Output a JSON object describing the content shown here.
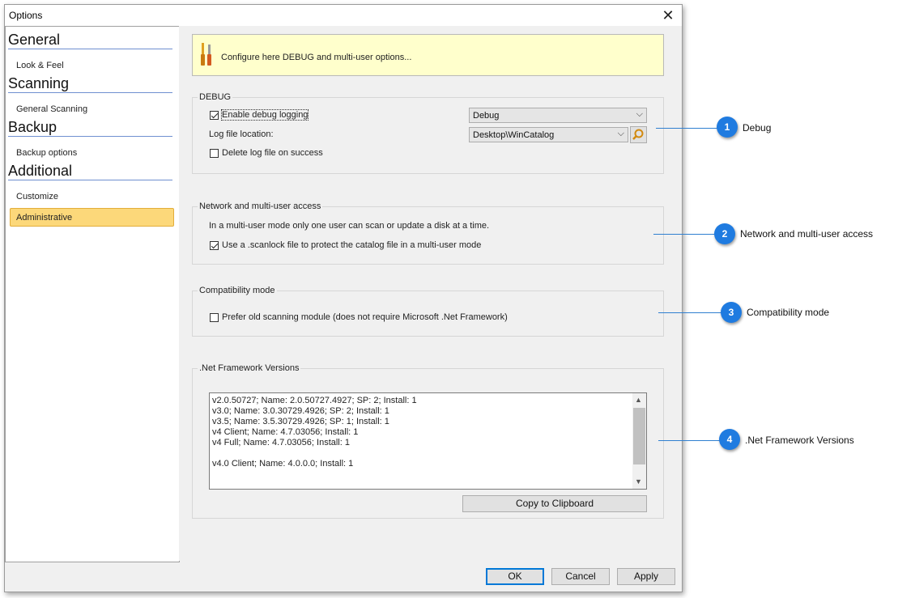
{
  "window": {
    "title": "Options",
    "close_glyph": "✕"
  },
  "nav": {
    "groups": [
      {
        "label": "General",
        "items": [
          "Look & Feel"
        ]
      },
      {
        "label": "Scanning",
        "items": [
          "General Scanning"
        ]
      },
      {
        "label": "Backup",
        "items": [
          "Backup options"
        ]
      },
      {
        "label": "Additional",
        "items": [
          "Customize",
          "Administrative"
        ]
      }
    ],
    "selected": "Administrative"
  },
  "banner": {
    "icon": "tools-icon",
    "text": "Configure here DEBUG and multi-user options..."
  },
  "debug": {
    "title": "DEBUG",
    "enable_label": "Enable debug logging",
    "enable_checked": true,
    "level_value": "Debug",
    "location_label": "Log file location:",
    "location_value": "Desktop\\WinCatalog",
    "browse_icon": "browse-folder-icon",
    "delete_label": "Delete log file on success",
    "delete_checked": false
  },
  "network": {
    "title": "Network and multi-user access",
    "description": "In a multi-user mode only one user can scan or update a disk at a time.",
    "scanlock_label": "Use a .scanlock file to protect the catalog file in a multi-user mode",
    "scanlock_checked": true
  },
  "compat": {
    "title": "Compatibility mode",
    "old_module_label": "Prefer old scanning module (does not require Microsoft .Net Framework)",
    "old_module_checked": false
  },
  "netfx": {
    "title": ".Net Framework Versions",
    "lines": [
      "v2.0.50727; Name: 2.0.50727.4927; SP: 2; Install: 1",
      "v3.0; Name: 3.0.30729.4926; SP: 2; Install: 1",
      "v3.5; Name: 3.5.30729.4926; SP: 1; Install: 1",
      "v4 Client; Name: 4.7.03056; Install: 1",
      "v4 Full; Name: 4.7.03056; Install: 1",
      "",
      "v4.0 Client; Name: 4.0.0.0; Install: 1"
    ],
    "copy_label": "Copy to Clipboard"
  },
  "footer": {
    "ok": "OK",
    "cancel": "Cancel",
    "apply": "Apply"
  },
  "callouts": [
    {
      "num": "1",
      "label": "Debug"
    },
    {
      "num": "2",
      "label": "Network and multi-user access"
    },
    {
      "num": "3",
      "label": "Compatibility mode"
    },
    {
      "num": "4",
      "label": ".Net Framework Versions"
    }
  ],
  "colors": {
    "accent": "#1f7be0",
    "selection": "#fcd87a",
    "banner": "#ffffcc"
  }
}
